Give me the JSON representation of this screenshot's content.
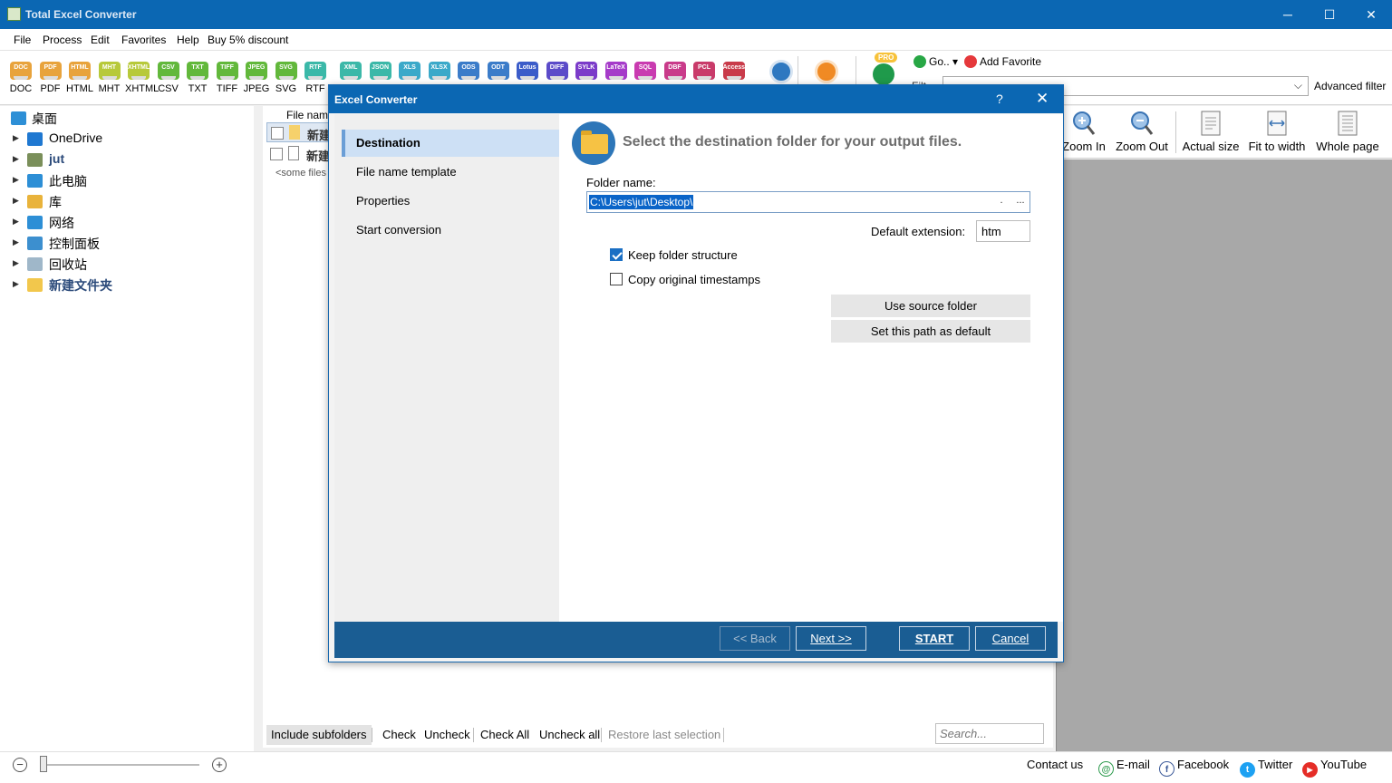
{
  "window": {
    "title": "Total Excel Converter",
    "controls": [
      "─",
      "☐",
      "✕"
    ]
  },
  "menu": [
    "File",
    "Process",
    "Edit",
    "Favorites",
    "Help",
    "Buy 5% discount"
  ],
  "toolbar": {
    "formats": [
      {
        "label": "DOC",
        "badge": "DOC",
        "color": "#e8a33c"
      },
      {
        "label": "PDF",
        "badge": "PDF",
        "color": "#e8a33c"
      },
      {
        "label": "HTML",
        "badge": "HTML",
        "color": "#e8a33c"
      },
      {
        "label": "MHT",
        "badge": "MHT",
        "color": "#b7c93a"
      },
      {
        "label": "XHTML",
        "badge": "XHTML",
        "color": "#b7c93a"
      },
      {
        "label": "CSV",
        "badge": "CSV",
        "color": "#62b83b"
      },
      {
        "label": "TXT",
        "badge": "TXT",
        "color": "#62b83b"
      },
      {
        "label": "TIFF",
        "badge": "TIFF",
        "color": "#62b83b"
      },
      {
        "label": "JPEG",
        "badge": "JPEG",
        "color": "#62b83b"
      },
      {
        "label": "SVG",
        "badge": "SVG",
        "color": "#62b83b"
      },
      {
        "label": "RTF",
        "badge": "RTF",
        "color": "#3bb8a8"
      }
    ],
    "more_formats": [
      {
        "badge": "XML",
        "color": "#3bb8a8"
      },
      {
        "badge": "JSON",
        "color": "#3bb8a8"
      },
      {
        "badge": "XLS",
        "color": "#3ba9c9"
      },
      {
        "badge": "XLSX",
        "color": "#3ba9c9"
      },
      {
        "badge": "ODS",
        "color": "#3b7cc9"
      },
      {
        "badge": "ODT",
        "color": "#3b7cc9"
      },
      {
        "badge": "Lotus",
        "color": "#3b5cc9"
      },
      {
        "badge": "DIFF",
        "color": "#5b4bc9"
      },
      {
        "badge": "SYLK",
        "color": "#7b3bc9"
      },
      {
        "badge": "LaTeX",
        "color": "#a53bc9"
      },
      {
        "badge": "SQL",
        "color": "#c93bb0"
      },
      {
        "badge": "DBF",
        "color": "#c93b8a"
      },
      {
        "badge": "PCL",
        "color": "#c93b6a"
      },
      {
        "badge": "Access",
        "color": "#c93b4a"
      }
    ],
    "go_label": "Go..",
    "add_favorite_label": "Add Favorite",
    "filter_label": "Filt",
    "advanced_filter_label": "Advanced filter",
    "pro_badge": "PRO"
  },
  "tree": {
    "root": "桌面",
    "items": [
      {
        "label": "OneDrive",
        "color": "#1f78d1",
        "bold": false
      },
      {
        "label": "jut",
        "color": "#7a8f5a",
        "bold": true
      },
      {
        "label": "此电脑",
        "color": "#2d8fd6",
        "bold": false
      },
      {
        "label": "库",
        "color": "#e9b33b",
        "bold": false
      },
      {
        "label": "网络",
        "color": "#2d8fd6",
        "bold": false
      },
      {
        "label": "控制面板",
        "color": "#3c8fcf",
        "bold": false
      },
      {
        "label": "回收站",
        "color": "#9fb7c9",
        "bold": false
      },
      {
        "label": "新建文件夹",
        "color": "#f2c74c",
        "bold": true
      }
    ]
  },
  "filelist": {
    "header": "File nam",
    "rows": [
      {
        "name": "新建"
      },
      {
        "name": "新建"
      }
    ],
    "placeholder": "<some files"
  },
  "listbar": {
    "buttons": [
      "Include subfolders",
      "Check",
      "Uncheck",
      "Check All",
      "Uncheck all",
      "Restore last selection"
    ],
    "search_placeholder": "Search..."
  },
  "preview_toolbar": [
    "Zoom In",
    "Zoom Out",
    "Actual size",
    "Fit to width",
    "Whole page"
  ],
  "statusbar": {
    "zoom_out": "−",
    "zoom_in": "+",
    "zoom_level": 0.02,
    "links": [
      {
        "label": "Contact us",
        "icon": "",
        "color": ""
      },
      {
        "label": "E-mail",
        "icon": "@",
        "color": "#2e9b4e"
      },
      {
        "label": "Facebook",
        "icon": "f",
        "color": "#ffffff"
      },
      {
        "label": "Twitter",
        "icon": "t",
        "color": "#1da1f2"
      },
      {
        "label": "YouTube",
        "icon": "▶",
        "color": "#e52d27"
      }
    ]
  },
  "dialog": {
    "title": "Excel Converter",
    "help": "?",
    "close": "✕",
    "nav": [
      "Destination",
      "File name template",
      "Properties",
      "Start conversion"
    ],
    "active_nav": 0,
    "heading": "Select the destination folder for your output files.",
    "folder_label": "Folder name:",
    "folder_value": "C:\\Users\\jut\\Desktop\\",
    "folder_btn_dot": ".",
    "folder_btn_browse": "...",
    "ext_label": "Default extension:",
    "ext_value": "htm",
    "keep_structure": {
      "label": "Keep folder structure",
      "checked": true
    },
    "copy_timestamps": {
      "label": "Copy original timestamps",
      "checked": false
    },
    "use_source_label": "Use source folder",
    "set_default_label": "Set this path as default",
    "footer": {
      "back": "<< Back",
      "next": "Next >>",
      "start": "START",
      "cancel": "Cancel"
    }
  }
}
